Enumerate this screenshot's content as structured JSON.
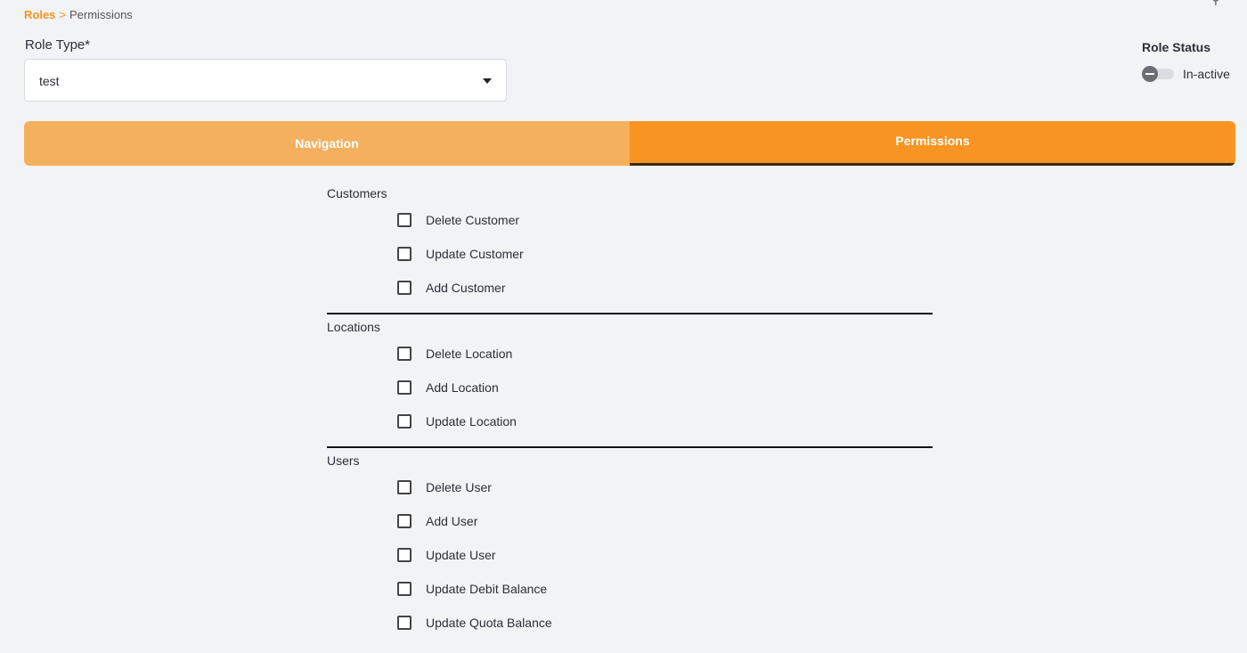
{
  "breadcrumb": {
    "parent": "Roles",
    "separator": ">",
    "current": "Permissions"
  },
  "role_type": {
    "label": "Role Type*",
    "value": "test"
  },
  "role_status": {
    "label": "Role Status",
    "state": "In-active"
  },
  "tabs": [
    {
      "label": "Navigation",
      "active": false
    },
    {
      "label": "Permissions",
      "active": true
    }
  ],
  "groups": [
    {
      "title": "Customers",
      "items": [
        "Delete Customer",
        "Update Customer",
        "Add Customer"
      ]
    },
    {
      "title": "Locations",
      "items": [
        "Delete Location",
        "Add Location",
        "Update Location"
      ]
    },
    {
      "title": "Users",
      "items": [
        "Delete User",
        "Add User",
        "Update User",
        "Update Debit Balance",
        "Update Quota Balance"
      ]
    }
  ],
  "colors": {
    "accent": "#f79422",
    "accent_light": "#f5b05e",
    "background": "#f2f3f5"
  }
}
